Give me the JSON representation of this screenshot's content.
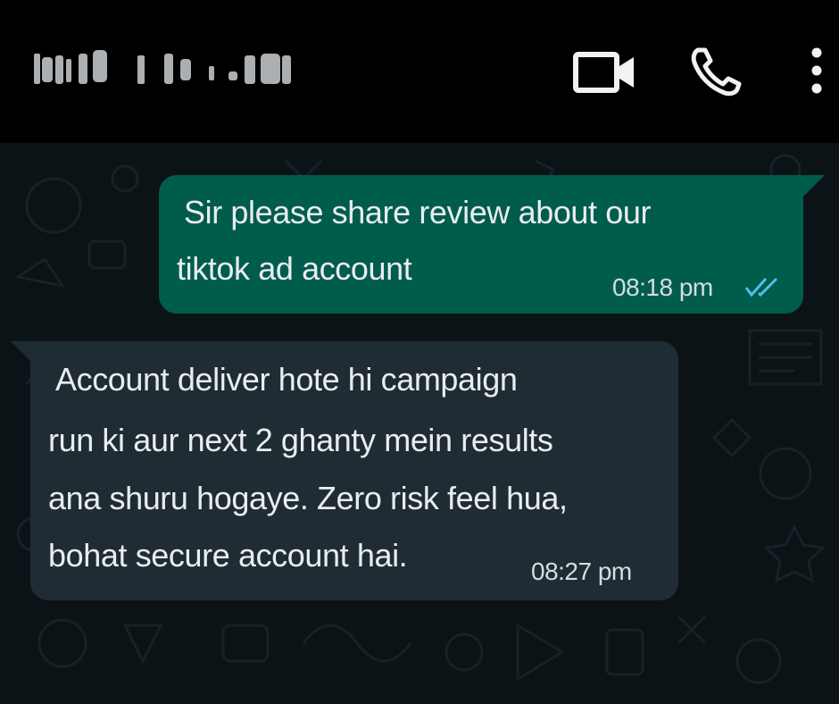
{
  "header": {
    "contact_name": "",
    "icons": [
      "video-call-icon",
      "voice-call-icon",
      "more-options-icon"
    ],
    "background_color": "#000000"
  },
  "messages": [
    {
      "direction": "outgoing",
      "lines": [
        "Sir please share review about our",
        "tiktok ad account"
      ],
      "time": "08:18 pm",
      "status": "read",
      "status_icon": "double-check-icon",
      "bubble_color": "#005c4b",
      "tick_color": "#53bdeb"
    },
    {
      "direction": "incoming",
      "lines": [
        "Account deliver hote hi campaign",
        "run ki aur next 2 ghanty mein results",
        "ana shuru hogaye. Zero risk feel hua,",
        "bohat secure account hai."
      ],
      "time": "08:27 pm",
      "bubble_color": "#202c33"
    }
  ],
  "chat_background_color": "#0c1317"
}
